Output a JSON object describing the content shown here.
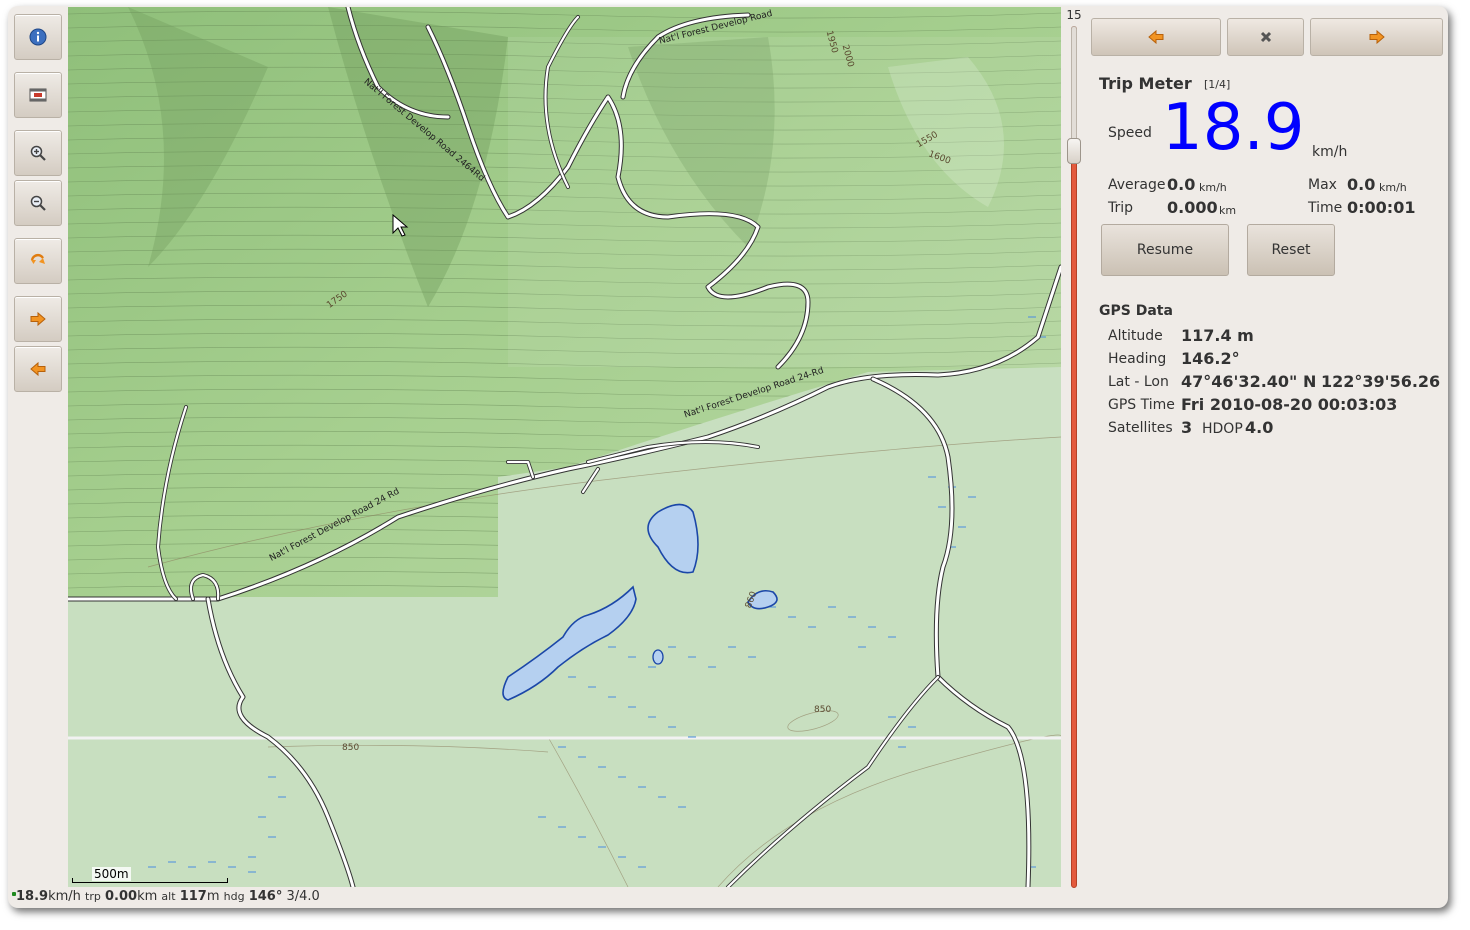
{
  "toolbar": {
    "buttons": [
      {
        "name": "info-button",
        "icon": "info-icon"
      },
      {
        "name": "map-source-button",
        "icon": "film-icon"
      },
      {
        "name": "zoom-in-button",
        "icon": "zoom-in-icon"
      },
      {
        "name": "zoom-out-button",
        "icon": "zoom-out-icon"
      },
      {
        "name": "recenter-button",
        "icon": "refresh-arrow-icon"
      },
      {
        "name": "forward-button",
        "icon": "arrow-right-icon"
      },
      {
        "name": "back-button",
        "icon": "arrow-left-icon"
      }
    ]
  },
  "map": {
    "scale_label": "500m",
    "road_labels": [
      "Nat'l Forest Develop Road 24 Rd",
      "Nat'l Forest Develop Road 24-Rd",
      "Nat'l Forest Develop Road 2464Rd",
      "Nat'l Forest Develop Road"
    ],
    "contour_labels": [
      "1750",
      "1550",
      "1600",
      "1950",
      "2000",
      "850",
      "850",
      "860"
    ]
  },
  "zoom": {
    "level": "15",
    "fraction": 0.14
  },
  "panel": {
    "nav": {
      "prev_icon": "arrow-left-icon",
      "close_icon": "close-icon",
      "next_icon": "arrow-right-icon"
    },
    "title": "Trip Meter",
    "page": "[1/4]",
    "speed_label": "Speed",
    "speed_value": "18.9",
    "speed_unit": "km/h",
    "average_label": "Average",
    "average_value": "0.0",
    "average_unit": "km/h",
    "max_label": "Max",
    "max_value": "0.0",
    "max_unit": "km/h",
    "trip_label": "Trip",
    "trip_value": "0.000",
    "trip_unit": "km",
    "time_label": "Time",
    "time_value": "0:00:01",
    "resume_label": "Resume",
    "reset_label": "Reset",
    "gps_title": "GPS Data",
    "altitude_label": "Altitude",
    "altitude_value": "117.4 m",
    "heading_label": "Heading",
    "heading_value": "146.2°",
    "latlon_label": "Lat - Lon",
    "lat_value": "47°46'32.40\" N",
    "lon_value": "122°39'56.26",
    "gpstime_label": "GPS Time",
    "gpstime_value": "Fri 2010-08-20 00:03:03",
    "satellites_label": "Satellites",
    "satellites_value": "3",
    "hdop_label": "HDOP",
    "hdop_value": "4.0"
  },
  "statusbar": {
    "speed": "18.9",
    "speed_unit": "km/h",
    "trip_label": "trp",
    "trip": "0.00",
    "trip_unit": "km",
    "alt_label": "alt",
    "alt": "117",
    "alt_unit": "m",
    "hdg_label": "hdg",
    "hdg": "146°",
    "sats": "3/4.0"
  },
  "colors": {
    "speed": "#0000ff",
    "water": "#b5d0f0",
    "forest": "#a3cf8c",
    "zoom_track": "#e35a3d"
  }
}
